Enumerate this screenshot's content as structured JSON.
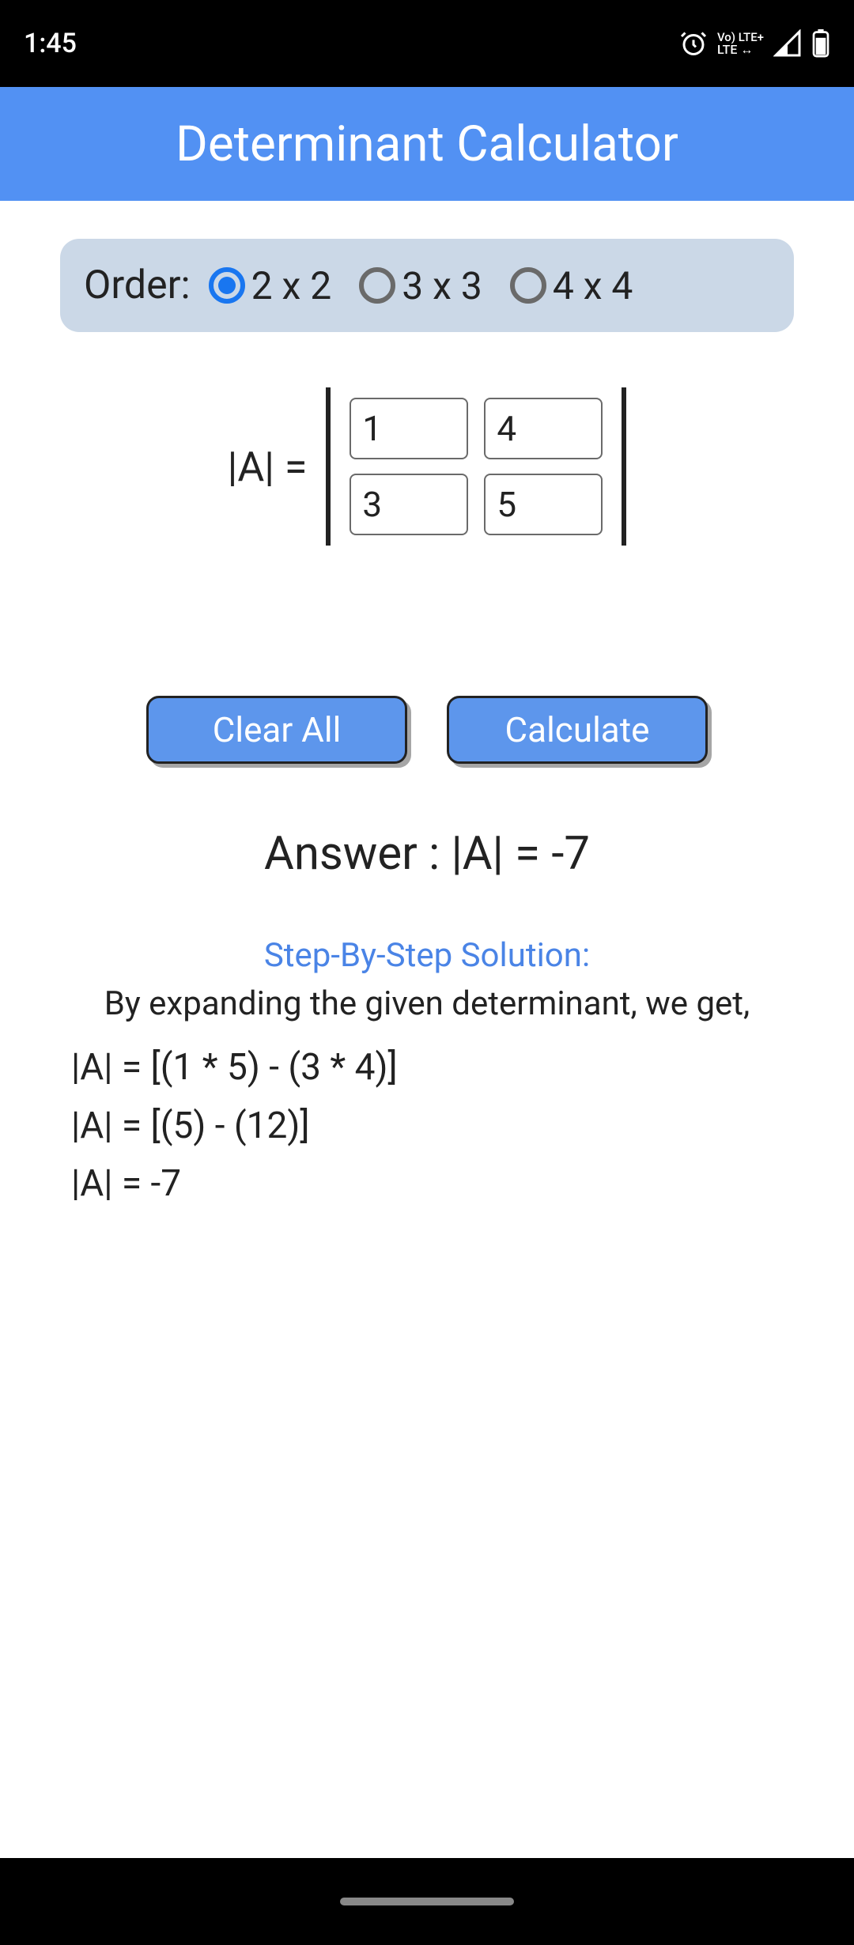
{
  "statusbar": {
    "time": "1:45",
    "lte_top": "Vo) LTE+",
    "lte_bottom": "LTE  ↔"
  },
  "header": {
    "title": "Determinant Calculator"
  },
  "order": {
    "label": "Order:",
    "options": [
      {
        "label": "2 x 2",
        "selected": true
      },
      {
        "label": "3 x 3",
        "selected": false
      },
      {
        "label": "4 x 4",
        "selected": false
      }
    ]
  },
  "matrix": {
    "label": "|A| =",
    "cells": [
      [
        "1",
        "4"
      ],
      [
        "3",
        "5"
      ]
    ]
  },
  "buttons": {
    "clear": "Clear All",
    "calculate": "Calculate"
  },
  "answer": {
    "text": "Answer : |A| = -7"
  },
  "solution": {
    "heading": "Step-By-Step Solution:",
    "intro": "By expanding the given determinant, we get,",
    "steps": [
      "|A| = [(1 * 5) - (3 * 4)]",
      "|A| = [(5) - (12)]",
      "|A| = -7"
    ]
  }
}
